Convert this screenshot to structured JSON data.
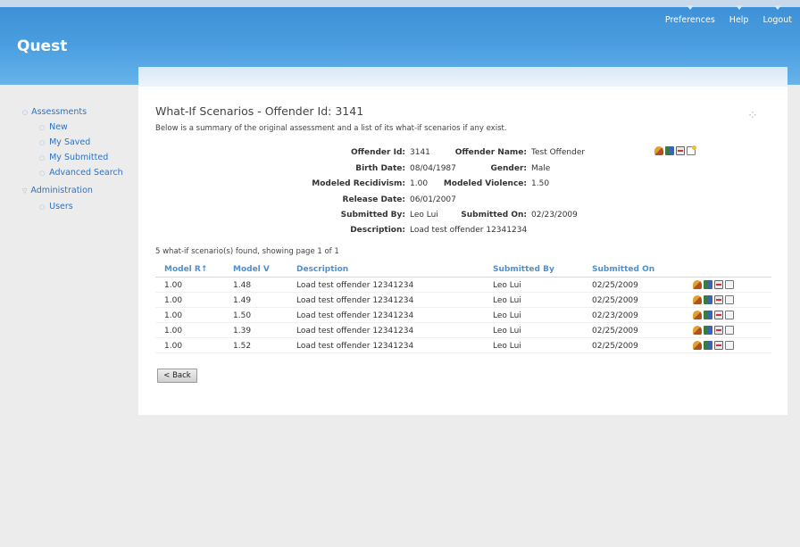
{
  "app": {
    "title": "Quest"
  },
  "topnav": [
    "Preferences",
    "Help",
    "Logout"
  ],
  "sidebar": {
    "groups": [
      {
        "label": "Assessments",
        "items": [
          "New",
          "My Saved",
          "My Submitted",
          "Advanced Search"
        ]
      },
      {
        "label": "Administration",
        "items": [
          "Users"
        ]
      }
    ]
  },
  "page": {
    "title": "What-If Scenarios - Offender Id: 3141",
    "subtitle": "Below is a summary of the original assessment and a list of its what-if scenarios if any exist."
  },
  "details": {
    "offender_id_label": "Offender Id:",
    "offender_id": "3141",
    "birth_date_label": "Birth Date:",
    "birth_date": "08/04/1987",
    "modeled_recidivism_label": "Modeled Recidivism:",
    "modeled_recidivism": "1.00",
    "release_date_label": "Release Date:",
    "release_date": "06/01/2007",
    "submitted_by_label": "Submitted By:",
    "submitted_by": "Leo Lui",
    "description_label": "Description:",
    "description": "Load test offender 12341234",
    "offender_name_label": "Offender Name:",
    "offender_name": "Test Offender",
    "gender_label": "Gender:",
    "gender": "Male",
    "modeled_violence_label": "Modeled Violence:",
    "modeled_violence": "1.50",
    "submitted_on_label": "Submitted On:",
    "submitted_on": "02/23/2009"
  },
  "summary": "5 what-if scenario(s) found, showing page 1 of 1",
  "table": {
    "headers": [
      "Model R↑",
      "Model V",
      "Description",
      "Submitted By",
      "Submitted On"
    ],
    "rows": [
      [
        "1.00",
        "1.48",
        "Load test offender 12341234",
        "Leo Lui",
        "02/25/2009"
      ],
      [
        "1.00",
        "1.49",
        "Load test offender 12341234",
        "Leo Lui",
        "02/25/2009"
      ],
      [
        "1.00",
        "1.50",
        "Load test offender 12341234",
        "Leo Lui",
        "02/23/2009"
      ],
      [
        "1.00",
        "1.39",
        "Load test offender 12341234",
        "Leo Lui",
        "02/25/2009"
      ],
      [
        "1.00",
        "1.52",
        "Load test offender 12341234",
        "Leo Lui",
        "02/25/2009"
      ]
    ]
  },
  "buttons": {
    "back": "< Back"
  },
  "icons": {
    "header_actions": [
      "people-icon",
      "cards-icon",
      "chart-icon",
      "new-document-icon"
    ],
    "row_actions": [
      "people-icon",
      "cards-icon",
      "chart-icon",
      "document-icon"
    ]
  },
  "colors": {
    "header": "#4b9fe0",
    "link": "#2a73c6",
    "table_header": "#4e8fce"
  }
}
